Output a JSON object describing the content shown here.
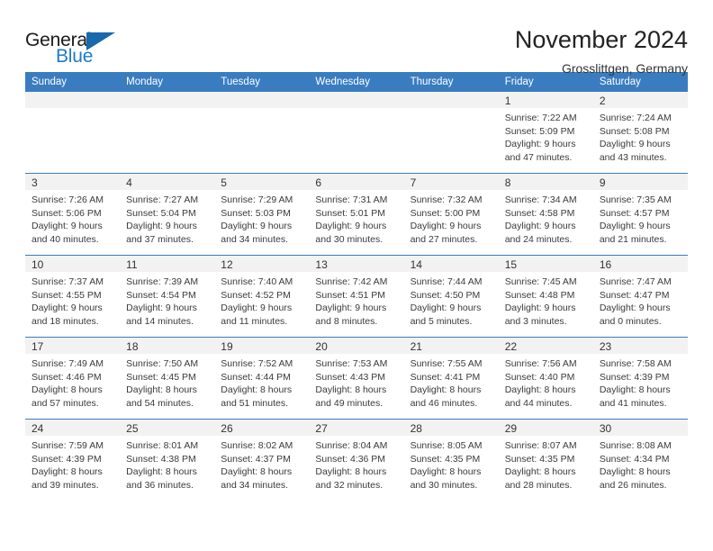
{
  "brand": {
    "name_part1": "General",
    "name_part2": "Blue",
    "triangle_color": "#1769ac",
    "blue_text_color": "#1e7bc8"
  },
  "header": {
    "title": "November 2024",
    "location": "Grosslittgen, Germany"
  },
  "theme": {
    "header_row_bg": "#3a7cc0",
    "header_row_text": "#ffffff",
    "daynum_band_bg": "#f2f2f2",
    "grid_line": "#3a7cc0",
    "body_text": "#3a3a3a"
  },
  "weekday_headers": [
    "Sunday",
    "Monday",
    "Tuesday",
    "Wednesday",
    "Thursday",
    "Friday",
    "Saturday"
  ],
  "weeks": [
    [
      {
        "day": "",
        "empty": true
      },
      {
        "day": "",
        "empty": true
      },
      {
        "day": "",
        "empty": true
      },
      {
        "day": "",
        "empty": true
      },
      {
        "day": "",
        "empty": true
      },
      {
        "day": "1",
        "sunrise": "Sunrise: 7:22 AM",
        "sunset": "Sunset: 5:09 PM",
        "daylight_line1": "Daylight: 9 hours",
        "daylight_line2": "and 47 minutes."
      },
      {
        "day": "2",
        "sunrise": "Sunrise: 7:24 AM",
        "sunset": "Sunset: 5:08 PM",
        "daylight_line1": "Daylight: 9 hours",
        "daylight_line2": "and 43 minutes."
      }
    ],
    [
      {
        "day": "3",
        "sunrise": "Sunrise: 7:26 AM",
        "sunset": "Sunset: 5:06 PM",
        "daylight_line1": "Daylight: 9 hours",
        "daylight_line2": "and 40 minutes."
      },
      {
        "day": "4",
        "sunrise": "Sunrise: 7:27 AM",
        "sunset": "Sunset: 5:04 PM",
        "daylight_line1": "Daylight: 9 hours",
        "daylight_line2": "and 37 minutes."
      },
      {
        "day": "5",
        "sunrise": "Sunrise: 7:29 AM",
        "sunset": "Sunset: 5:03 PM",
        "daylight_line1": "Daylight: 9 hours",
        "daylight_line2": "and 34 minutes."
      },
      {
        "day": "6",
        "sunrise": "Sunrise: 7:31 AM",
        "sunset": "Sunset: 5:01 PM",
        "daylight_line1": "Daylight: 9 hours",
        "daylight_line2": "and 30 minutes."
      },
      {
        "day": "7",
        "sunrise": "Sunrise: 7:32 AM",
        "sunset": "Sunset: 5:00 PM",
        "daylight_line1": "Daylight: 9 hours",
        "daylight_line2": "and 27 minutes."
      },
      {
        "day": "8",
        "sunrise": "Sunrise: 7:34 AM",
        "sunset": "Sunset: 4:58 PM",
        "daylight_line1": "Daylight: 9 hours",
        "daylight_line2": "and 24 minutes."
      },
      {
        "day": "9",
        "sunrise": "Sunrise: 7:35 AM",
        "sunset": "Sunset: 4:57 PM",
        "daylight_line1": "Daylight: 9 hours",
        "daylight_line2": "and 21 minutes."
      }
    ],
    [
      {
        "day": "10",
        "sunrise": "Sunrise: 7:37 AM",
        "sunset": "Sunset: 4:55 PM",
        "daylight_line1": "Daylight: 9 hours",
        "daylight_line2": "and 18 minutes."
      },
      {
        "day": "11",
        "sunrise": "Sunrise: 7:39 AM",
        "sunset": "Sunset: 4:54 PM",
        "daylight_line1": "Daylight: 9 hours",
        "daylight_line2": "and 14 minutes."
      },
      {
        "day": "12",
        "sunrise": "Sunrise: 7:40 AM",
        "sunset": "Sunset: 4:52 PM",
        "daylight_line1": "Daylight: 9 hours",
        "daylight_line2": "and 11 minutes."
      },
      {
        "day": "13",
        "sunrise": "Sunrise: 7:42 AM",
        "sunset": "Sunset: 4:51 PM",
        "daylight_line1": "Daylight: 9 hours",
        "daylight_line2": "and 8 minutes."
      },
      {
        "day": "14",
        "sunrise": "Sunrise: 7:44 AM",
        "sunset": "Sunset: 4:50 PM",
        "daylight_line1": "Daylight: 9 hours",
        "daylight_line2": "and 5 minutes."
      },
      {
        "day": "15",
        "sunrise": "Sunrise: 7:45 AM",
        "sunset": "Sunset: 4:48 PM",
        "daylight_line1": "Daylight: 9 hours",
        "daylight_line2": "and 3 minutes."
      },
      {
        "day": "16",
        "sunrise": "Sunrise: 7:47 AM",
        "sunset": "Sunset: 4:47 PM",
        "daylight_line1": "Daylight: 9 hours",
        "daylight_line2": "and 0 minutes."
      }
    ],
    [
      {
        "day": "17",
        "sunrise": "Sunrise: 7:49 AM",
        "sunset": "Sunset: 4:46 PM",
        "daylight_line1": "Daylight: 8 hours",
        "daylight_line2": "and 57 minutes."
      },
      {
        "day": "18",
        "sunrise": "Sunrise: 7:50 AM",
        "sunset": "Sunset: 4:45 PM",
        "daylight_line1": "Daylight: 8 hours",
        "daylight_line2": "and 54 minutes."
      },
      {
        "day": "19",
        "sunrise": "Sunrise: 7:52 AM",
        "sunset": "Sunset: 4:44 PM",
        "daylight_line1": "Daylight: 8 hours",
        "daylight_line2": "and 51 minutes."
      },
      {
        "day": "20",
        "sunrise": "Sunrise: 7:53 AM",
        "sunset": "Sunset: 4:43 PM",
        "daylight_line1": "Daylight: 8 hours",
        "daylight_line2": "and 49 minutes."
      },
      {
        "day": "21",
        "sunrise": "Sunrise: 7:55 AM",
        "sunset": "Sunset: 4:41 PM",
        "daylight_line1": "Daylight: 8 hours",
        "daylight_line2": "and 46 minutes."
      },
      {
        "day": "22",
        "sunrise": "Sunrise: 7:56 AM",
        "sunset": "Sunset: 4:40 PM",
        "daylight_line1": "Daylight: 8 hours",
        "daylight_line2": "and 44 minutes."
      },
      {
        "day": "23",
        "sunrise": "Sunrise: 7:58 AM",
        "sunset": "Sunset: 4:39 PM",
        "daylight_line1": "Daylight: 8 hours",
        "daylight_line2": "and 41 minutes."
      }
    ],
    [
      {
        "day": "24",
        "sunrise": "Sunrise: 7:59 AM",
        "sunset": "Sunset: 4:39 PM",
        "daylight_line1": "Daylight: 8 hours",
        "daylight_line2": "and 39 minutes."
      },
      {
        "day": "25",
        "sunrise": "Sunrise: 8:01 AM",
        "sunset": "Sunset: 4:38 PM",
        "daylight_line1": "Daylight: 8 hours",
        "daylight_line2": "and 36 minutes."
      },
      {
        "day": "26",
        "sunrise": "Sunrise: 8:02 AM",
        "sunset": "Sunset: 4:37 PM",
        "daylight_line1": "Daylight: 8 hours",
        "daylight_line2": "and 34 minutes."
      },
      {
        "day": "27",
        "sunrise": "Sunrise: 8:04 AM",
        "sunset": "Sunset: 4:36 PM",
        "daylight_line1": "Daylight: 8 hours",
        "daylight_line2": "and 32 minutes."
      },
      {
        "day": "28",
        "sunrise": "Sunrise: 8:05 AM",
        "sunset": "Sunset: 4:35 PM",
        "daylight_line1": "Daylight: 8 hours",
        "daylight_line2": "and 30 minutes."
      },
      {
        "day": "29",
        "sunrise": "Sunrise: 8:07 AM",
        "sunset": "Sunset: 4:35 PM",
        "daylight_line1": "Daylight: 8 hours",
        "daylight_line2": "and 28 minutes."
      },
      {
        "day": "30",
        "sunrise": "Sunrise: 8:08 AM",
        "sunset": "Sunset: 4:34 PM",
        "daylight_line1": "Daylight: 8 hours",
        "daylight_line2": "and 26 minutes."
      }
    ]
  ]
}
